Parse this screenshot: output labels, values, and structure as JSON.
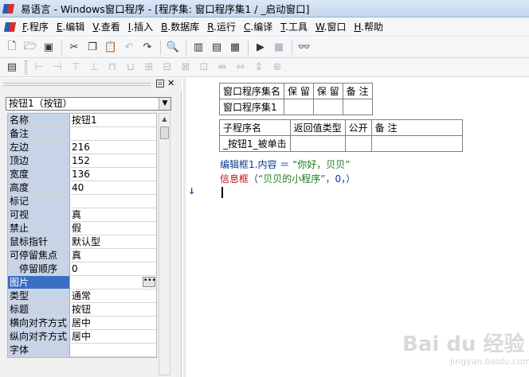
{
  "window": {
    "title": "易语言 - Windows窗口程序 - [程序集: 窗口程序集1 / _启动窗口]"
  },
  "menu": [
    {
      "prefix": "F",
      "label": "程序"
    },
    {
      "prefix": "E",
      "label": "编辑"
    },
    {
      "prefix": "V",
      "label": "查看"
    },
    {
      "prefix": "I",
      "label": "插入"
    },
    {
      "prefix": "B",
      "label": "数据库"
    },
    {
      "prefix": "R",
      "label": "运行"
    },
    {
      "prefix": "C",
      "label": "编译"
    },
    {
      "prefix": "T",
      "label": "工具"
    },
    {
      "prefix": "W",
      "label": "窗口"
    },
    {
      "prefix": "H",
      "label": "帮助"
    }
  ],
  "toolbar_icons": [
    "new-file-icon",
    "open-folder-icon",
    "save-icon",
    "cut-icon",
    "copy-icon",
    "paste-icon",
    "undo-disabled-icon",
    "redo-icon",
    "find-icon",
    "layout-1-icon",
    "layout-2-icon",
    "layout-3-icon",
    "run-icon",
    "stop-icon",
    "binoculars-icon"
  ],
  "property_panel": {
    "selected_component": "按钮1（按钮）",
    "properties": [
      {
        "name": "名称",
        "value": "按钮1"
      },
      {
        "name": "备注",
        "value": ""
      },
      {
        "name": "左边",
        "value": "216"
      },
      {
        "name": "顶边",
        "value": "152"
      },
      {
        "name": "宽度",
        "value": "136"
      },
      {
        "name": "高度",
        "value": "40"
      },
      {
        "name": "标记",
        "value": ""
      },
      {
        "name": "可视",
        "value": "真"
      },
      {
        "name": "禁止",
        "value": "假"
      },
      {
        "name": "鼠标指针",
        "value": "默认型"
      },
      {
        "name": "可停留焦点",
        "value": "真"
      },
      {
        "name": "停留顺序",
        "value": "0"
      },
      {
        "name": "图片",
        "value": ""
      },
      {
        "name": "类型",
        "value": "通常"
      },
      {
        "name": "标题",
        "value": "按钮"
      },
      {
        "name": "横向对齐方式",
        "value": "居中"
      },
      {
        "name": "纵向对齐方式",
        "value": "居中"
      },
      {
        "name": "字体",
        "value": ""
      }
    ]
  },
  "assembly_table": {
    "headers": [
      "窗口程序集名",
      "保 留",
      "保 留",
      "备 注"
    ],
    "row": [
      "窗口程序集1",
      "",
      "",
      ""
    ]
  },
  "subroutine_table": {
    "headers": [
      "子程序名",
      "返回值类型",
      "公开",
      "备 注"
    ],
    "row": [
      "_按钮1_被单击",
      "",
      "",
      ""
    ]
  },
  "code": {
    "line1_target": "编辑框1.内容 ＝ ",
    "line1_string": "“你好，贝贝”",
    "line2_func": "信息框",
    "line2_open": "（",
    "line2_string": "“贝贝的小程序”",
    "line2_args": "，0，",
    "line2_close": "）"
  },
  "watermark": {
    "logo": "Bai du 经验",
    "url": "jingyan.baidu.com"
  }
}
